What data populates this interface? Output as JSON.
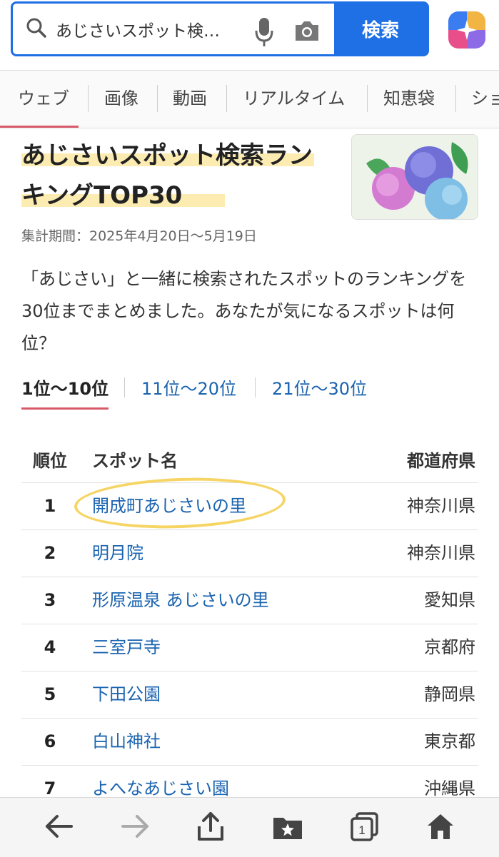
{
  "search": {
    "query": "あじさいスポット検…",
    "button_label": "検索"
  },
  "tabs": [
    "ウェブ",
    "画像",
    "動画",
    "リアルタイム",
    "知恵袋",
    "ショ"
  ],
  "article": {
    "title": "あじさいスポット検索ランキングTOP30",
    "period": "集計期間：2025年4月20日～5月19日",
    "description": "「あじさい」と一緒に検索されたスポットのランキングを30位までまとめました。あなたが気になるスポットは何位？",
    "range_tabs": [
      "1位～10位",
      "11位～20位",
      "21位～30位"
    ]
  },
  "table": {
    "headers": {
      "rank": "順位",
      "name": "スポット名",
      "pref": "都道府県"
    },
    "rows": [
      {
        "rank": "1",
        "name": "開成町あじさいの里",
        "pref": "神奈川県"
      },
      {
        "rank": "2",
        "name": "明月院",
        "pref": "神奈川県"
      },
      {
        "rank": "3",
        "name": "形原温泉 あじさいの里",
        "pref": "愛知県"
      },
      {
        "rank": "4",
        "name": "三室戸寺",
        "pref": "京都府"
      },
      {
        "rank": "5",
        "name": "下田公園",
        "pref": "静岡県"
      },
      {
        "rank": "6",
        "name": "白山神社",
        "pref": "東京都"
      },
      {
        "rank": "7",
        "name": "よへなあじさい園",
        "pref": "沖縄県"
      }
    ]
  },
  "toolbar": {
    "tab_count": "1"
  },
  "colors": {
    "accent": "#1f6fe5",
    "link": "#1a63b0",
    "tab_underline": "#d85a6a",
    "highlight": "#fde9a5",
    "marker_circle": "#f6d565"
  }
}
